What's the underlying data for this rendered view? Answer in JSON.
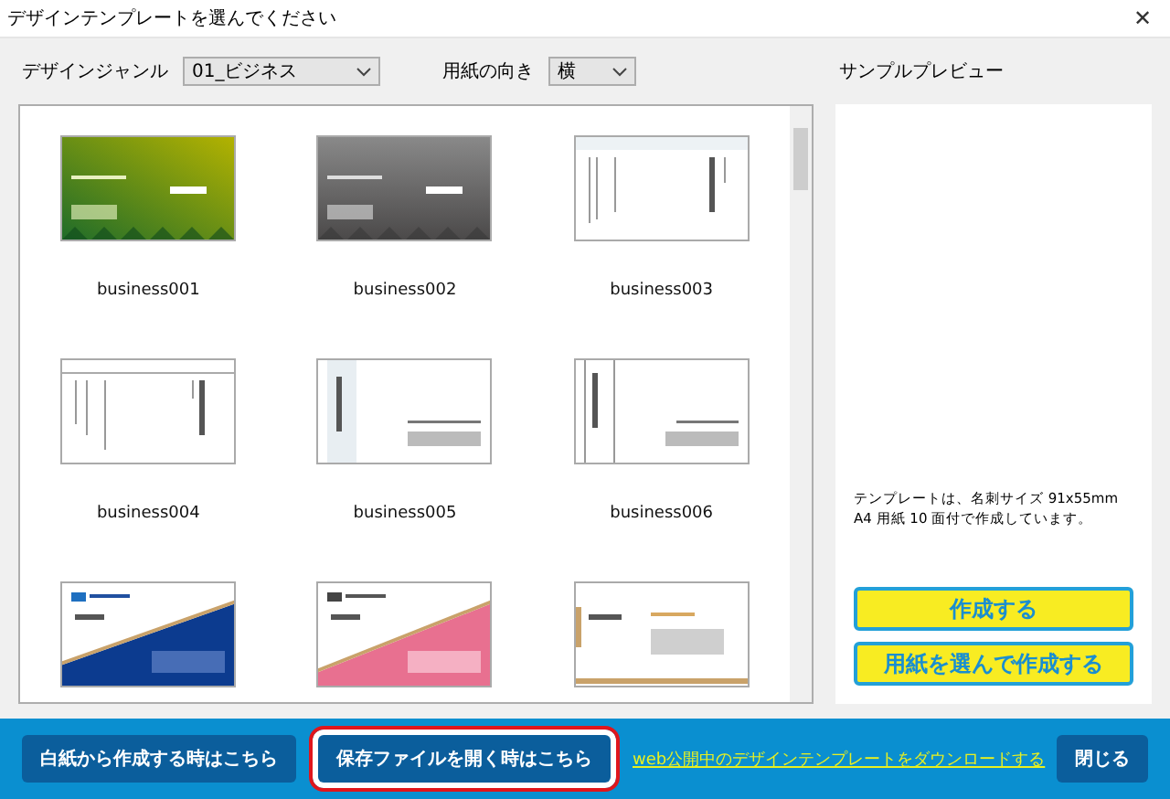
{
  "window": {
    "title": "デザインテンプレートを選んでください",
    "close": "✕"
  },
  "filters": [
    {
      "label": "デザインジャンル",
      "value": "01_ビジネス",
      "kind": "wide"
    },
    {
      "label": "用紙の向き",
      "value": "横",
      "kind": "narrow"
    }
  ],
  "templates": [
    {
      "name": "business001",
      "kind": "green"
    },
    {
      "name": "business002",
      "kind": "gray"
    },
    {
      "name": "business003",
      "kind": "vertical"
    },
    {
      "name": "business004",
      "kind": "vertical-plain"
    },
    {
      "name": "business005",
      "kind": "sidebar"
    },
    {
      "name": "business006",
      "kind": "double-line"
    },
    {
      "kind": "blue-diagonal"
    },
    {
      "kind": "pink-diagonal"
    },
    {
      "kind": "gold"
    }
  ],
  "preview": {
    "title": "サンプルプレビュー",
    "description": "テンプレートは、名刺サイズ 91x55mm\nA4 用紙 10 面付で作成しています。",
    "buttons": [
      "作成する",
      "用紙を選んで作成する"
    ]
  },
  "footer": [
    {
      "kind": "button",
      "label": "白紙から作成する時はこちら",
      "highlighted": false
    },
    {
      "kind": "button",
      "label": "保存ファイルを開く時はこちら",
      "highlighted": true
    },
    {
      "kind": "link",
      "label": "web公開中のデザインテンプレートをダウンロードする"
    },
    {
      "kind": "button",
      "label": "閉じる",
      "highlighted": false
    }
  ]
}
